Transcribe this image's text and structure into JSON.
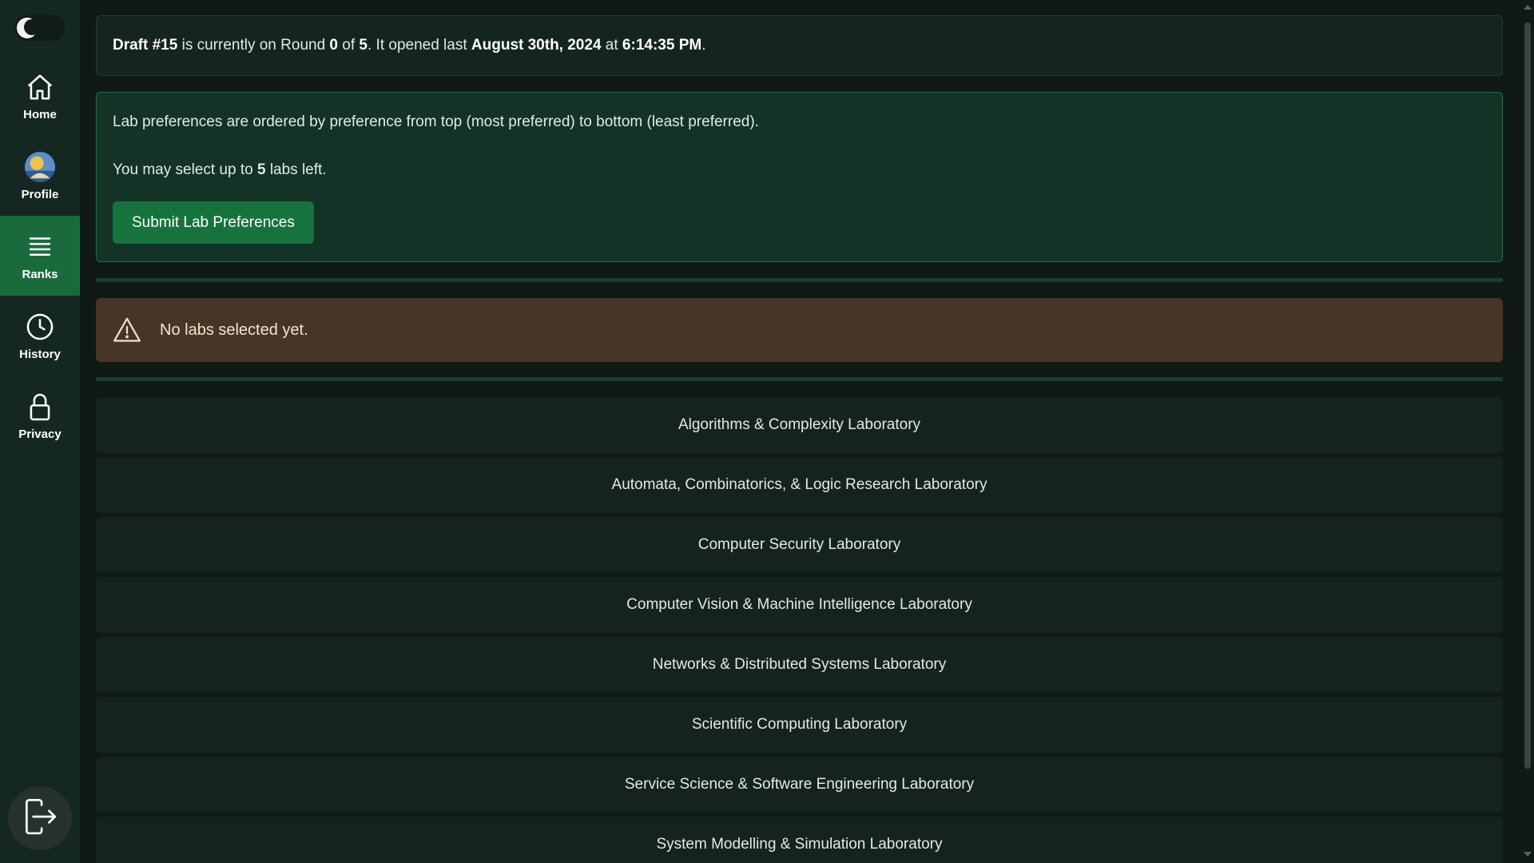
{
  "sidebar": {
    "theme_toggle_icon": "moon-icon",
    "items": [
      {
        "label": "Home",
        "icon": "home-icon"
      },
      {
        "label": "Profile",
        "icon": "avatar"
      },
      {
        "label": "Ranks",
        "icon": "list-icon",
        "active": true
      },
      {
        "label": "History",
        "icon": "clock-icon"
      },
      {
        "label": "Privacy",
        "icon": "lock-icon"
      }
    ],
    "logout_icon": "logout-icon"
  },
  "draft": {
    "name": "Draft #15",
    "text_1": " is currently on Round ",
    "round": "0",
    "text_2": " of ",
    "total_rounds": "5",
    "text_3": ". It opened last ",
    "date": "August 30th, 2024",
    "text_4": " at ",
    "time": "6:14:35 PM",
    "text_5": "."
  },
  "preferences": {
    "instructions": "Lab preferences are ordered by preference from top (most preferred) to bottom (least preferred).",
    "remaining_prefix": "You may select up to ",
    "remaining_count": "5",
    "remaining_suffix": " labs left.",
    "submit_label": "Submit Lab Preferences"
  },
  "warning": {
    "icon": "warning-icon",
    "message": "No labs selected yet."
  },
  "labs": [
    "Algorithms & Complexity Laboratory",
    "Automata, Combinatorics, & Logic Research Laboratory",
    "Computer Security Laboratory",
    "Computer Vision & Machine Intelligence Laboratory",
    "Networks & Distributed Systems Laboratory",
    "Scientific Computing Laboratory",
    "Service Science & Software Engineering Laboratory",
    "System Modelling & Simulation Laboratory"
  ],
  "colors": {
    "accent": "#17733d",
    "warning_bg": "#473626",
    "sidebar_active": "#1a6b3c"
  }
}
